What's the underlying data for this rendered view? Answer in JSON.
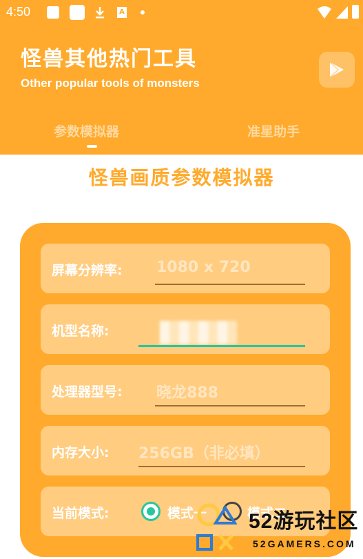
{
  "status_bar": {
    "time": "4:50",
    "icons": [
      "image-icon",
      "app-icon",
      "download-icon",
      "a-icon",
      "dot-icon",
      "wifi-icon",
      "signal-icon",
      "battery-icon"
    ],
    "a_icon_label": "A"
  },
  "header": {
    "title": "怪兽其他热门工具",
    "subtitle": "Other popular tools of monsters",
    "action_icon": "play-store-icon",
    "tabs": [
      {
        "label": "参数模拟器",
        "active": true
      },
      {
        "label": "准星助手",
        "active": false
      }
    ]
  },
  "main": {
    "title": "怪兽画质参数模拟器",
    "fields": [
      {
        "label": "屏幕分辨率:",
        "placeholder": "1080 x 720",
        "value": ""
      },
      {
        "label": "机型名称:",
        "placeholder": "",
        "value": "",
        "focused": true
      },
      {
        "label": "处理器型号:",
        "placeholder": "晓龙888",
        "value": ""
      },
      {
        "label": "内存大小:",
        "placeholder": "256GB（非必填）",
        "value": ""
      }
    ],
    "mode": {
      "label": "当前模式:",
      "options": [
        {
          "label": "模式一",
          "selected": true
        },
        {
          "label": "模式二",
          "selected": false
        }
      ]
    }
  },
  "watermark": {
    "text": "52游玩社区",
    "url": "52GAMERS.COM"
  },
  "colors": {
    "primary": "#FFAA2C",
    "field_bg": "#FFCC80",
    "accent": "#26C6A0",
    "white": "#FFFFFF"
  }
}
